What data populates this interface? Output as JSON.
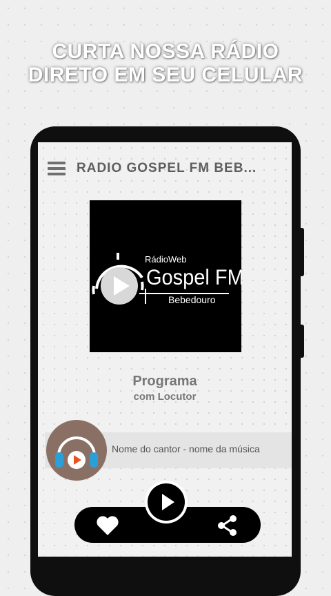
{
  "promo": {
    "line1": "CURTA NOSSA RÁDIO",
    "line2": "DIRETO EM SEU CELULAR"
  },
  "app_bar": {
    "title": "RADIO GOSPEL FM BEB...",
    "menu_icon": "hamburger-menu-icon"
  },
  "station_logo": {
    "top_text": "RádioWeb",
    "main_text": "Gospel FM",
    "sub_text": "Bebedouro"
  },
  "program": {
    "title": "Programa",
    "subtitle": "com Locutor"
  },
  "now_playing": {
    "text": "Nome do cantor - nome da música"
  },
  "controls": {
    "play_icon": "play-icon",
    "favorite_icon": "heart-icon",
    "share_icon": "share-icon"
  },
  "colors": {
    "background": "#efefef",
    "phone_frame": "#0f0f0f",
    "accent_orange": "#e8541e",
    "headphone_blue": "#2a9fd8",
    "disc_brown": "#8a7064"
  }
}
